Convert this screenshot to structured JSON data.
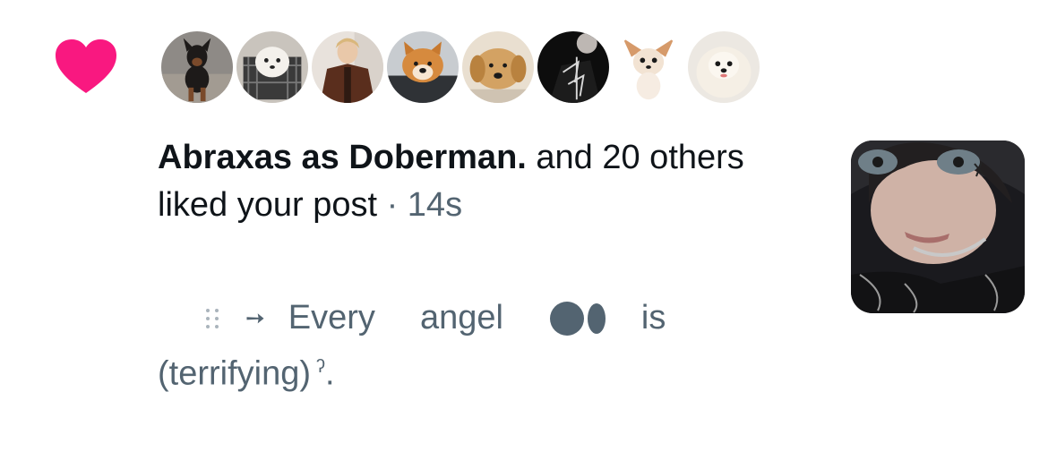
{
  "notification": {
    "actor_name": "Abraxas as Doberman.",
    "action_text": " and 20 others liked your post",
    "separator": " · ",
    "timestamp": "14s",
    "avatars": [
      {
        "name": "doberman-puppy"
      },
      {
        "name": "samoyed-puppy-in-cage"
      },
      {
        "name": "person-in-brown-suit"
      },
      {
        "name": "akita-dog"
      },
      {
        "name": "golden-retriever-puppy"
      },
      {
        "name": "dark-figure"
      },
      {
        "name": "chihuahua"
      },
      {
        "name": "white-pomeranian"
      }
    ],
    "post_preview": {
      "dots_glyph": "⁝⁝",
      "arrow_glyph": "➙",
      "word_every": "Every",
      "word_angel": "angel",
      "word_is": "is",
      "line2": "(terrifying)",
      "superscript": "ʔ",
      "end_punct": "."
    }
  },
  "colors": {
    "heart": "#f91880",
    "primary_text": "#0f1419",
    "secondary_text": "#536471",
    "background": "#ffffff"
  }
}
